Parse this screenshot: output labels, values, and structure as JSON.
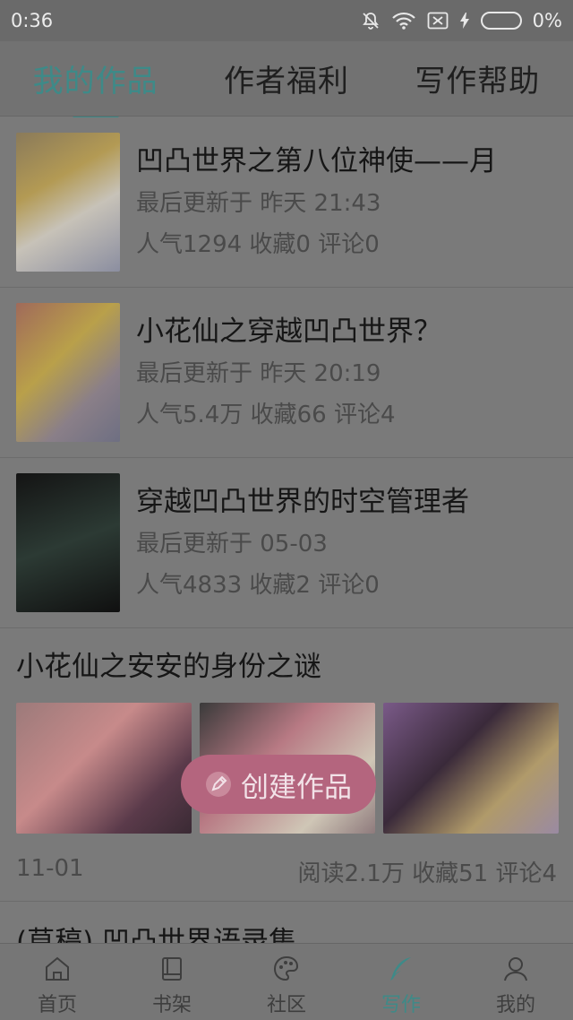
{
  "status_bar": {
    "time": "0:36",
    "battery_percent": "0%",
    "icons": [
      "mute-bell-icon",
      "wifi-icon",
      "sim-off-icon",
      "charging-icon",
      "battery-icon"
    ]
  },
  "tabs": [
    {
      "label": "我的作品",
      "active": true
    },
    {
      "label": "作者福利",
      "active": false
    },
    {
      "label": "写作帮助",
      "active": false
    }
  ],
  "works": [
    {
      "title": "凹凸世界之第八位神使——月",
      "updated": "最后更新于 昨天 21:43",
      "stats": "人气1294 收藏0 评论0"
    },
    {
      "title": "小花仙之穿越凹凸世界？",
      "updated": "最后更新于 昨天 20:19",
      "stats": "人气5.4万 收藏66 评论4"
    },
    {
      "title": "穿越凹凸世界的时空管理者",
      "updated": "最后更新于 05-03",
      "stats": "人气4833 收藏2 评论0"
    }
  ],
  "series": {
    "title": "小花仙之安安的身份之谜",
    "date": "11-01",
    "stats": "阅读2.1万 收藏51 评论4"
  },
  "partial_title": "(草稿) 凹凸世界语录集",
  "fab": {
    "label": "创建作品",
    "icon": "pencil-icon",
    "color": "#b4657e"
  },
  "bottom_nav": [
    {
      "label": "首页",
      "icon": "home-icon",
      "active": false
    },
    {
      "label": "书架",
      "icon": "book-icon",
      "active": false
    },
    {
      "label": "社区",
      "icon": "palette-icon",
      "active": false
    },
    {
      "label": "写作",
      "icon": "quill-icon",
      "active": true
    },
    {
      "label": "我的",
      "icon": "user-icon",
      "active": false
    }
  ],
  "colors": {
    "accent": "#3e8a88",
    "fab": "#b4657e"
  }
}
